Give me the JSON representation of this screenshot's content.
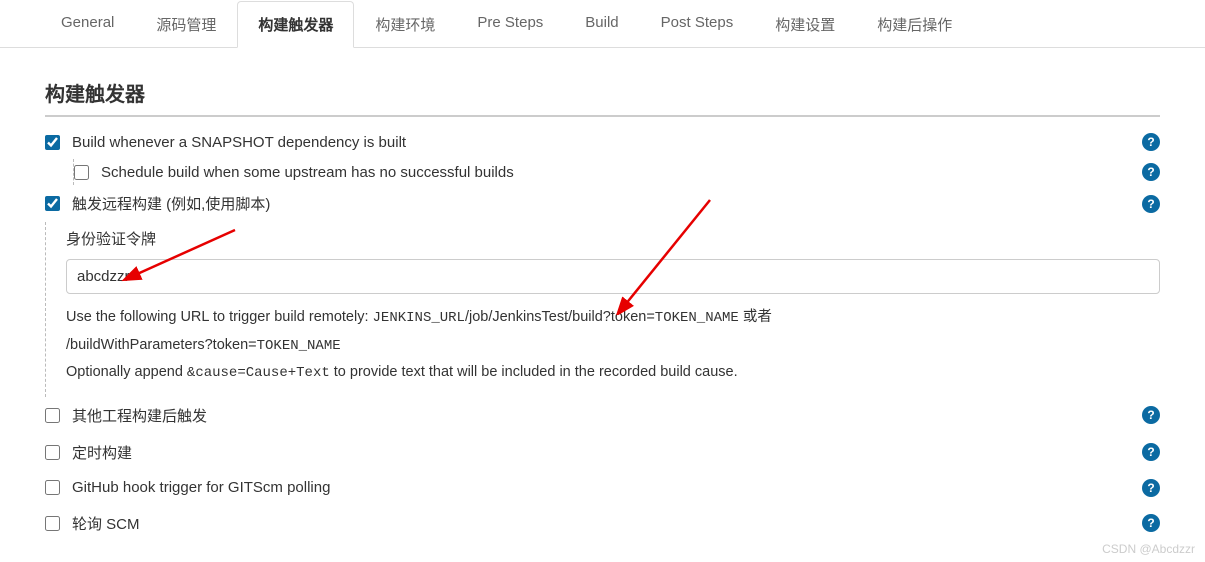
{
  "tabs": [
    {
      "label": "General"
    },
    {
      "label": "源码管理"
    },
    {
      "label": "构建触发器"
    },
    {
      "label": "构建环境"
    },
    {
      "label": "Pre Steps"
    },
    {
      "label": "Build"
    },
    {
      "label": "Post Steps"
    },
    {
      "label": "构建设置"
    },
    {
      "label": "构建后操作"
    }
  ],
  "section_title": "构建触发器",
  "options": {
    "snapshot": {
      "label": "Build whenever a SNAPSHOT dependency is built",
      "checked": true
    },
    "schedule": {
      "label": "Schedule build when some upstream has no successful builds",
      "checked": false
    },
    "remote": {
      "label": "触发远程构建 (例如,使用脚本)",
      "checked": true
    },
    "other_projects": {
      "label": "其他工程构建后触发",
      "checked": false
    },
    "timed": {
      "label": "定时构建",
      "checked": false
    },
    "github_hook": {
      "label": "GitHub hook trigger for GITScm polling",
      "checked": false
    },
    "poll_scm": {
      "label": "轮询 SCM",
      "checked": false
    }
  },
  "token_field": {
    "label": "身份验证令牌",
    "value": "abcdzzr"
  },
  "help_text": {
    "line1_prefix": "Use the following URL to trigger build remotely: ",
    "line1_mono": "JENKINS_URL",
    "line1_mid": "/job/JenkinsTest/build?token=",
    "line1_token": "TOKEN_NAME",
    "line1_suffix": " 或者",
    "line2_prefix": "/buildWithParameters?token=",
    "line2_token": "TOKEN_NAME",
    "line3_prefix": "Optionally append ",
    "line3_mono": "&cause=Cause+Text",
    "line3_suffix": " to provide text that will be included in the recorded build cause."
  },
  "watermark": "CSDN @Abcdzzr",
  "help_glyph": "?"
}
